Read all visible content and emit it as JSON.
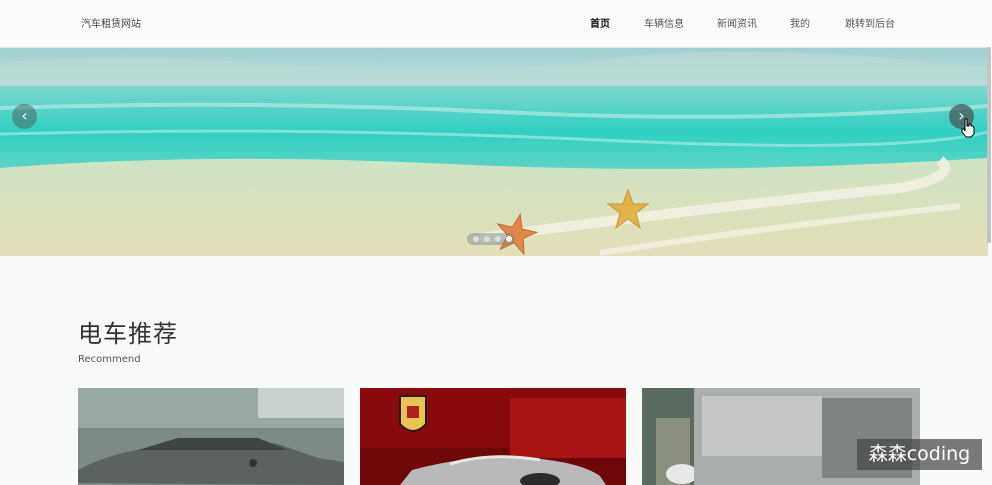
{
  "header": {
    "brand": "汽车租赁网站",
    "nav": [
      {
        "label": "首页",
        "active": true
      },
      {
        "label": "车辆信息",
        "active": false
      },
      {
        "label": "新闻资讯",
        "active": false
      },
      {
        "label": "我的",
        "active": false
      },
      {
        "label": "跳转到后台",
        "active": false
      }
    ]
  },
  "carousel": {
    "image": "beach-with-starfish",
    "prev_icon": "chevron-left-icon",
    "next_icon": "chevron-right-icon",
    "slide_count": 4,
    "active_index": 3
  },
  "section": {
    "title": "电车推荐",
    "subtitle": "Recommend"
  },
  "cards": [
    {
      "image": "gray-suv-photo"
    },
    {
      "image": "porsche-sports-car-photo"
    },
    {
      "image": "blurred-car-photo"
    }
  ],
  "watermark": "森森coding",
  "colors": {
    "page_bg": "#f8fbf8",
    "sea_turquoise": "#2fd0c0",
    "sand": "#e4dfb8"
  }
}
